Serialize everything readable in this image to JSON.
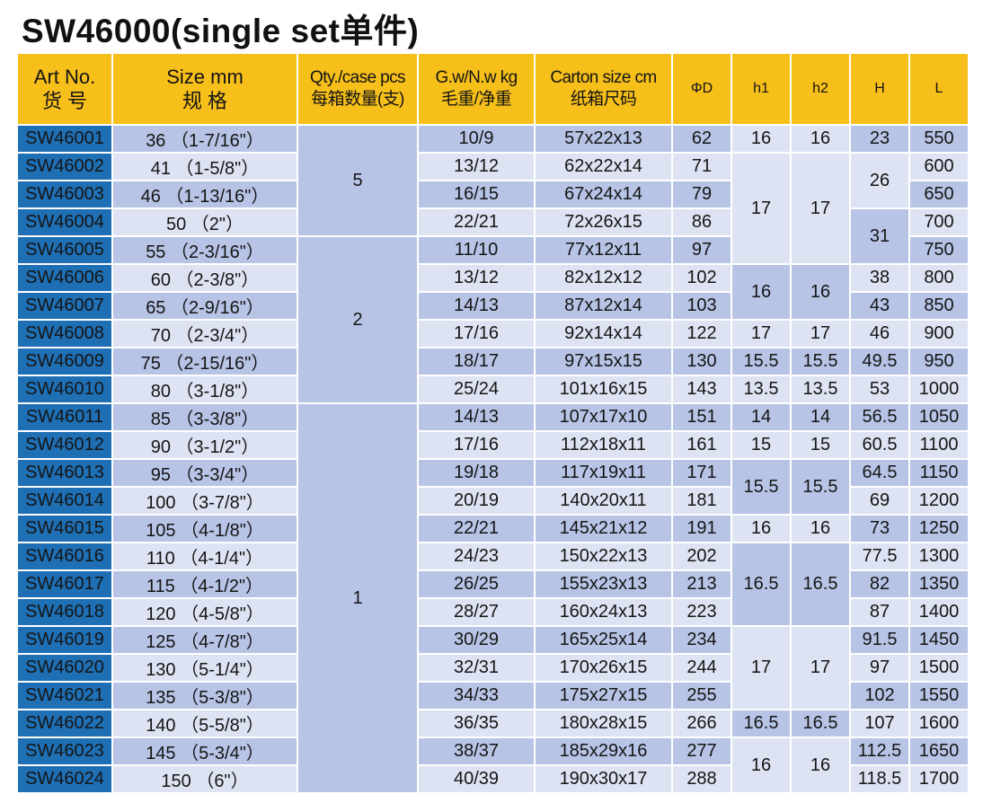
{
  "title": "SW46000(single set单件)",
  "headers": {
    "art": [
      "Art No.",
      "货 号"
    ],
    "size": [
      "Size mm",
      "规 格"
    ],
    "qty": [
      "Qty./case pcs",
      "每箱数量(支)"
    ],
    "gw": [
      "G.w/N.w kg",
      "毛重/净重"
    ],
    "carton": [
      "Carton size cm",
      "纸箱尺码"
    ],
    "phid": "ΦD",
    "h1": "h1",
    "h2": "h2",
    "H": "H",
    "L": "L"
  },
  "rows": [
    {
      "art": "SW46001",
      "size": "36 （1-7/16\"）",
      "gw": "10/9",
      "carton": "57x22x13",
      "phid": "62",
      "H": "23",
      "L": "550"
    },
    {
      "art": "SW46002",
      "size": "41 （1-5/8\"）",
      "gw": "13/12",
      "carton": "62x22x14",
      "phid": "71",
      "H": "",
      "L": "600"
    },
    {
      "art": "SW46003",
      "size": "46 （1-13/16\"）",
      "gw": "16/15",
      "carton": "67x24x14",
      "phid": "79",
      "H": "",
      "L": "650"
    },
    {
      "art": "SW46004",
      "size": "50 （2\"）",
      "gw": "22/21",
      "carton": "72x26x15",
      "phid": "86",
      "H": "",
      "L": "700"
    },
    {
      "art": "SW46005",
      "size": "55 （2-3/16\"）",
      "gw": "11/10",
      "carton": "77x12x11",
      "phid": "97",
      "H": "",
      "L": "750"
    },
    {
      "art": "SW46006",
      "size": "60 （2-3/8\"）",
      "gw": "13/12",
      "carton": "82x12x12",
      "phid": "102",
      "H": "38",
      "L": "800"
    },
    {
      "art": "SW46007",
      "size": "65 （2-9/16\"）",
      "gw": "14/13",
      "carton": "87x12x14",
      "phid": "103",
      "H": "43",
      "L": "850"
    },
    {
      "art": "SW46008",
      "size": "70 （2-3/4\"）",
      "gw": "17/16",
      "carton": "92x14x14",
      "phid": "122",
      "H": "46",
      "L": "900"
    },
    {
      "art": "SW46009",
      "size": "75 （2-15/16\"）",
      "gw": "18/17",
      "carton": "97x15x15",
      "phid": "130",
      "H": "49.5",
      "L": "950"
    },
    {
      "art": "SW46010",
      "size": "80 （3-1/8\"）",
      "gw": "25/24",
      "carton": "101x16x15",
      "phid": "143",
      "H": "53",
      "L": "1000"
    },
    {
      "art": "SW46011",
      "size": "85 （3-3/8\"）",
      "gw": "14/13",
      "carton": "107x17x10",
      "phid": "151",
      "H": "56.5",
      "L": "1050"
    },
    {
      "art": "SW46012",
      "size": "90 （3-1/2\"）",
      "gw": "17/16",
      "carton": "112x18x11",
      "phid": "161",
      "H": "60.5",
      "L": "1100"
    },
    {
      "art": "SW46013",
      "size": "95 （3-3/4\"）",
      "gw": "19/18",
      "carton": "117x19x11",
      "phid": "171",
      "H": "64.5",
      "L": "1150"
    },
    {
      "art": "SW46014",
      "size": "100 （3-7/8\"）",
      "gw": "20/19",
      "carton": "140x20x11",
      "phid": "181",
      "H": "69",
      "L": "1200"
    },
    {
      "art": "SW46015",
      "size": "105 （4-1/8\"）",
      "gw": "22/21",
      "carton": "145x21x12",
      "phid": "191",
      "H": "73",
      "L": "1250"
    },
    {
      "art": "SW46016",
      "size": "110 （4-1/4\"）",
      "gw": "24/23",
      "carton": "150x22x13",
      "phid": "202",
      "H": "77.5",
      "L": "1300"
    },
    {
      "art": "SW46017",
      "size": "115 （4-1/2\"）",
      "gw": "26/25",
      "carton": "155x23x13",
      "phid": "213",
      "H": "82",
      "L": "1350"
    },
    {
      "art": "SW46018",
      "size": "120 （4-5/8\"）",
      "gw": "28/27",
      "carton": "160x24x13",
      "phid": "223",
      "H": "87",
      "L": "1400"
    },
    {
      "art": "SW46019",
      "size": "125 （4-7/8\"）",
      "gw": "30/29",
      "carton": "165x25x14",
      "phid": "234",
      "H": "91.5",
      "L": "1450"
    },
    {
      "art": "SW46020",
      "size": "130 （5-1/4\"）",
      "gw": "32/31",
      "carton": "170x26x15",
      "phid": "244",
      "H": "97",
      "L": "1500"
    },
    {
      "art": "SW46021",
      "size": "135 （5-3/8\"）",
      "gw": "34/33",
      "carton": "175x27x15",
      "phid": "255",
      "H": "102",
      "L": "1550"
    },
    {
      "art": "SW46022",
      "size": "140 （5-5/8\"）",
      "gw": "36/35",
      "carton": "180x28x15",
      "phid": "266",
      "H": "107",
      "L": "1600"
    },
    {
      "art": "SW46023",
      "size": "145 （5-3/4\"）",
      "gw": "38/37",
      "carton": "185x29x16",
      "phid": "277",
      "H": "112.5",
      "L": "1650"
    },
    {
      "art": "SW46024",
      "size": "150 （6\"）",
      "gw": "40/39",
      "carton": "190x30x17",
      "phid": "288",
      "H": "118.5",
      "L": "1700"
    }
  ],
  "qty_groups": [
    {
      "start": 0,
      "span": 4,
      "value": "5"
    },
    {
      "start": 4,
      "span": 6,
      "value": "2"
    },
    {
      "start": 10,
      "span": 14,
      "value": "1"
    }
  ],
  "h_groups": [
    {
      "start": 0,
      "span": 1,
      "value": "16",
      "shade": "lt"
    },
    {
      "start": 1,
      "span": 4,
      "value": "17",
      "shade": "lt"
    },
    {
      "start": 5,
      "span": 2,
      "value": "16",
      "shade": "dk"
    },
    {
      "start": 7,
      "span": 1,
      "value": "17",
      "shade": "lt"
    },
    {
      "start": 8,
      "span": 1,
      "value": "15.5",
      "shade": "dk"
    },
    {
      "start": 9,
      "span": 1,
      "value": "13.5",
      "shade": "lt"
    },
    {
      "start": 10,
      "span": 1,
      "value": "14",
      "shade": "dk"
    },
    {
      "start": 11,
      "span": 1,
      "value": "15",
      "shade": "lt"
    },
    {
      "start": 12,
      "span": 2,
      "value": "15.5",
      "shade": "dk"
    },
    {
      "start": 14,
      "span": 1,
      "value": "16",
      "shade": "lt"
    },
    {
      "start": 15,
      "span": 3,
      "value": "16.5",
      "shade": "dk"
    },
    {
      "start": 18,
      "span": 3,
      "value": "17",
      "shade": "lt"
    },
    {
      "start": 21,
      "span": 1,
      "value": "16.5",
      "shade": "dk"
    },
    {
      "start": 22,
      "span": 2,
      "value": "16",
      "shade": "lt"
    }
  ],
  "H_groups": [
    {
      "start": 1,
      "span": 2,
      "value": "26",
      "shade": "lt"
    },
    {
      "start": 3,
      "span": 2,
      "value": "31",
      "shade": "dk"
    }
  ],
  "colors": {
    "header": "#f6bf1a",
    "art": "#1f6fb5",
    "shade_dark": "#b8c4e6",
    "shade_light": "#dde3f3"
  }
}
